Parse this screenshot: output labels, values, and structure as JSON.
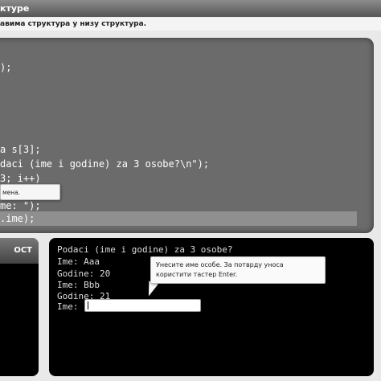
{
  "window": {
    "title": "ктуре"
  },
  "instruction": "авима структура у низу структура.",
  "code": {
    "lines": [
      ");",
      "a s[3];",
      "daci (ime i godine) za 3 osobe?\\n\");",
      "3; i++)",
      "me: \");",
      ".ime);"
    ],
    "tooltip": "мена."
  },
  "side_panel": {
    "header": "ОСТ"
  },
  "console": {
    "lines": [
      "Podaci (ime i godine) za 3 osobe?",
      "Ime: Aaa",
      "Godine: 20",
      "Ime: Bbb",
      "Godine: 21",
      "Ime:"
    ],
    "input_value": "",
    "tooltip": "Унесите име особе. За потврду уноса користити тастер Enter."
  }
}
